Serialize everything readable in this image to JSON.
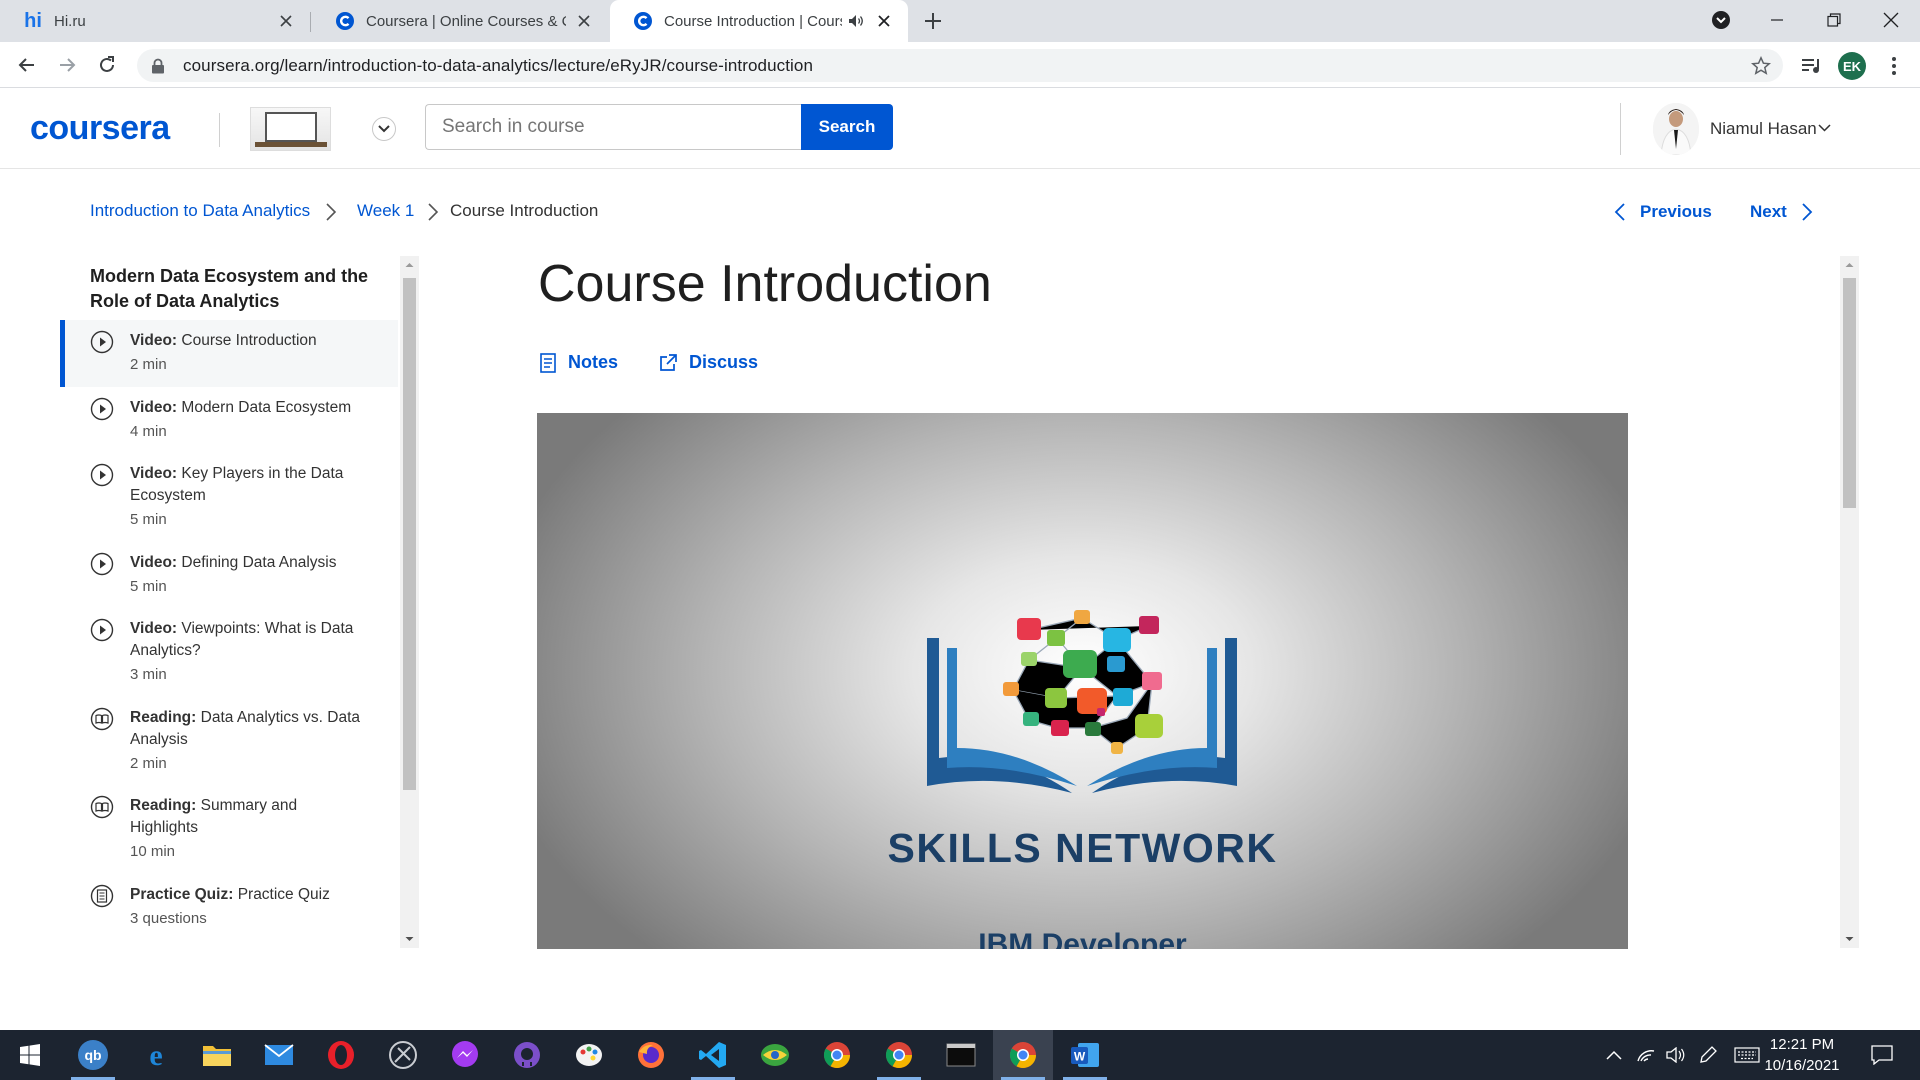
{
  "browser": {
    "tabs": [
      {
        "title": "Hi.ru",
        "favicon": "hi-favicon"
      },
      {
        "title": "Coursera | Online Courses & Credentials",
        "favicon": "coursera-favicon"
      },
      {
        "title": "Course Introduction | Coursera",
        "favicon": "coursera-favicon",
        "audio": true
      }
    ],
    "new_tab": "+",
    "url": "coursera.org/learn/introduction-to-data-analytics/lecture/eRyJR/course-introduction",
    "profile_initials": "EK"
  },
  "header": {
    "logo": "coursera",
    "search_placeholder": "Search in course",
    "search_button": "Search",
    "user_name": "Niamul Hasan"
  },
  "breadcrumb": {
    "course": "Introduction to Data Analytics",
    "week": "Week 1",
    "current": "Course Introduction"
  },
  "pager": {
    "previous": "Previous",
    "next": "Next"
  },
  "sidebar": {
    "module_title": "Modern Data Ecosystem and the Role of Data Analytics",
    "items": [
      {
        "kind": "Video:",
        "title": "Course Introduction",
        "duration": "2 min",
        "icon": "play-circle-icon",
        "active": true
      },
      {
        "kind": "Video:",
        "title": "Modern Data Ecosystem",
        "duration": "4 min",
        "icon": "play-circle-icon"
      },
      {
        "kind": "Video:",
        "title": "Key Players in the Data Ecosystem",
        "duration": "5 min",
        "icon": "play-circle-icon"
      },
      {
        "kind": "Video:",
        "title": "Defining Data Analysis",
        "duration": "5 min",
        "icon": "play-circle-icon"
      },
      {
        "kind": "Video:",
        "title": "Viewpoints: What is Data Analytics?",
        "duration": "3 min",
        "icon": "play-circle-icon"
      },
      {
        "kind": "Reading:",
        "title": "Data Analytics vs. Data Analysis",
        "duration": "2 min",
        "icon": "book-icon"
      },
      {
        "kind": "Reading:",
        "title": "Summary and Highlights",
        "duration": "10 min",
        "icon": "book-icon"
      },
      {
        "kind": "Practice Quiz:",
        "title": "Practice Quiz",
        "duration": "3 questions",
        "icon": "quiz-icon"
      }
    ]
  },
  "main": {
    "title": "Course Introduction",
    "notes_label": "Notes",
    "discuss_label": "Discuss",
    "video": {
      "brand": "SKILLS NETWORK",
      "subtitle": "IBM Developer"
    }
  },
  "taskbar": {
    "time": "12:21 PM",
    "date": "10/16/2021"
  },
  "colors": {
    "accent": "#0056d2",
    "tabstrip": "#dee1e6",
    "taskbar": "#1c2430",
    "brand_navy": "#1b3f66"
  }
}
